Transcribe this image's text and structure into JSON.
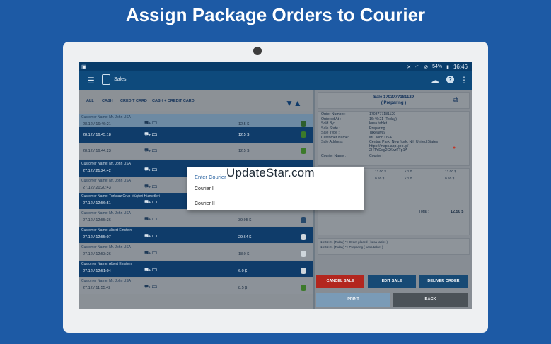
{
  "headline": "Assign Package Orders to Courier",
  "status_bar": {
    "battery": "54%",
    "time": "16:46"
  },
  "app_bar": {
    "title": "Sales"
  },
  "tabs": [
    "ALL",
    "CASH",
    "CREDIT CARD",
    "CASH + CREDIT CARD"
  ],
  "orders": [
    {
      "customer": "Customer Name: Mr. John USA",
      "date": "28.12 / 16:46:21",
      "amount": "12.5 $",
      "style": "highlight",
      "status_color": "#2e5e2e"
    },
    {
      "customer": "",
      "date": "28.12 / 16:45:18",
      "amount": "12.5 $",
      "style": "dark",
      "status_color": "#3c7a2a"
    },
    {
      "customer": "",
      "date": "28.12 / 16:44:23",
      "amount": "12.5 $",
      "style": "light",
      "status_color": "#3c7a2a"
    },
    {
      "customer": "Customer Name: Mr. John USA",
      "date": "27.12 / 21:24:42",
      "amount": "",
      "style": "dark",
      "status_color": ""
    },
    {
      "customer": "Customer Name: Mr. John USA",
      "date": "27.12 / 21:20:43",
      "amount": "",
      "style": "light",
      "status_color": ""
    },
    {
      "customer": "Customer Name: Turkuaz Grup Müşteri Hizmetleri",
      "date": "27.12 / 12:56:51",
      "amount": "",
      "style": "dark",
      "status_color": ""
    },
    {
      "customer": "Customer Name: Mr. John USA",
      "date": "27.12 / 12:55:36",
      "amount": "39.95 $",
      "style": "light",
      "status_color": "#26496c"
    },
    {
      "customer": "Customer Name: Albert Einstein",
      "date": "27.12 / 12:55:07",
      "amount": "29.64 $",
      "style": "dark",
      "status_color": "#cfd6dc"
    },
    {
      "customer": "Customer Name: Mr. John USA",
      "date": "27.12 / 12:53:26",
      "amount": "18.0 $",
      "style": "light",
      "status_color": "#cfd6dc"
    },
    {
      "customer": "Customer Name: Albert Einstein",
      "date": "27.12 / 12:51:04",
      "amount": "6.0 $",
      "style": "dark",
      "status_color": "#cfd6dc"
    },
    {
      "customer": "Customer Name: Mr. John USA",
      "date": "27.12 / 11:55:42",
      "amount": "8.5 $",
      "style": "light",
      "status_color": "#3c7a2a"
    }
  ],
  "sale_detail": {
    "title_line1": "Sale 1703777181129",
    "title_line2": "( Preparing )",
    "rows": [
      {
        "k": "Order Number:",
        "v": "1703777181129"
      },
      {
        "k": "Ordered At :",
        "v": "16:46:21 (Today)"
      },
      {
        "k": "Sold By:",
        "v": "kasa tablet"
      },
      {
        "k": "Sale State :",
        "v": "Preparing"
      },
      {
        "k": "Sale Type :",
        "v": "Takeaway"
      },
      {
        "k": "Customer Name:",
        "v": "Mr. John USA"
      },
      {
        "k": "Sale Address :",
        "v": "Central Park, New York, NY, United States https://maps.app.goo.gl/ 2HTYDqg2CKwrFTp1A"
      },
      {
        "k": "Courier Name :",
        "v": "Courier I"
      }
    ],
    "items": [
      {
        "price": "12.00 $",
        "qty": "x 1.0",
        "total": "12.00 $"
      },
      {
        "price": "0.50 $",
        "qty": "x 1.0",
        "total": "0.50 $"
      }
    ],
    "total_label": "Total :",
    "total_value": "12.50 $",
    "log": [
      "16:46:21 (Today) * : Order placed ( kasa tablet )",
      "16:46:21 (Today) * : Preparing ( kasa tablet )"
    ]
  },
  "buttons": {
    "cancel": "CANCEL SALE",
    "edit": "EDIT SALE",
    "deliver": "DELIVER ORDER",
    "print": "PRINT",
    "back": "BACK"
  },
  "dialog": {
    "title": "Enter Courier",
    "options": [
      "Courier I",
      "Courier II"
    ]
  },
  "watermark": "UpdateStar.com",
  "colors": {
    "brand": "#1d5aa5",
    "cancel": "#b3261e",
    "action": "#0e4a7c"
  }
}
